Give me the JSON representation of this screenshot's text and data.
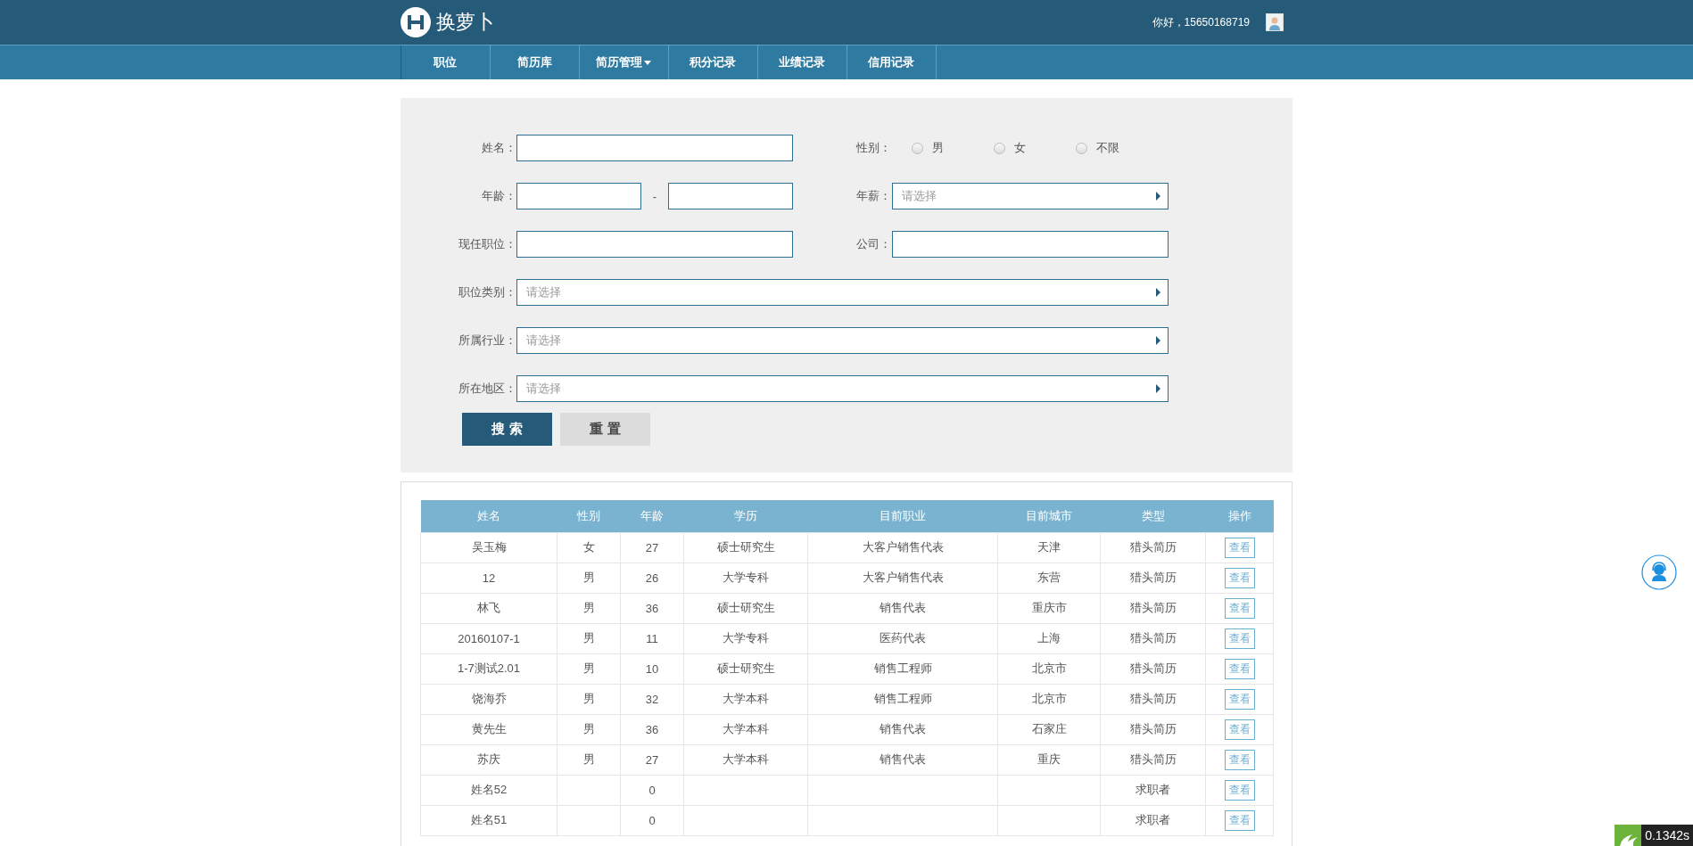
{
  "header": {
    "logo_text": "换萝卜",
    "greeting": "你好，15650168719"
  },
  "nav": [
    {
      "label": "职位",
      "dropdown": false
    },
    {
      "label": "简历库",
      "dropdown": false
    },
    {
      "label": "简历管理",
      "dropdown": true
    },
    {
      "label": "积分记录",
      "dropdown": false
    },
    {
      "label": "业绩记录",
      "dropdown": false
    },
    {
      "label": "信用记录",
      "dropdown": false
    }
  ],
  "form": {
    "name": {
      "label": "姓名："
    },
    "gender": {
      "label": "性别：",
      "options": [
        {
          "label": "男",
          "selected": false
        },
        {
          "label": "女",
          "selected": false
        },
        {
          "label": "不限",
          "selected": false
        }
      ]
    },
    "age": {
      "label": "年龄：",
      "separator": "-"
    },
    "salary": {
      "label": "年薪：",
      "placeholder": "请选择"
    },
    "position": {
      "label": "现任职位："
    },
    "company": {
      "label": "公司："
    },
    "selects": [
      {
        "label": "职位类别：",
        "placeholder": "请选择"
      },
      {
        "label": "所属行业：",
        "placeholder": "请选择"
      },
      {
        "label": "所在地区：",
        "placeholder": "请选择"
      }
    ],
    "buttons": [
      {
        "label": "搜 索",
        "kind": "primary"
      },
      {
        "label": "重 置",
        "kind": "secondary"
      }
    ]
  },
  "table": {
    "columns": [
      "姓名",
      "性别",
      "年龄",
      "学历",
      "目前职业",
      "目前城市",
      "类型",
      "操作"
    ],
    "rows": [
      {
        "cells": [
          "吴玉梅",
          "女",
          "27",
          "硕士研究生",
          "大客户销售代表",
          "天津",
          "猎头简历"
        ],
        "action": "查看"
      },
      {
        "cells": [
          "12",
          "男",
          "26",
          "大学专科",
          "大客户销售代表",
          "东营",
          "猎头简历"
        ],
        "action": "查看"
      },
      {
        "cells": [
          "林飞",
          "男",
          "36",
          "硕士研究生",
          "销售代表",
          "重庆市",
          "猎头简历"
        ],
        "action": "查看"
      },
      {
        "cells": [
          "20160107-1",
          "男",
          "11",
          "大学专科",
          "医药代表",
          "上海",
          "猎头简历"
        ],
        "action": "查看"
      },
      {
        "cells": [
          "1-7测试2.01",
          "男",
          "10",
          "硕士研究生",
          "销售工程师",
          "北京市",
          "猎头简历"
        ],
        "action": "查看"
      },
      {
        "cells": [
          "饶海乔",
          "男",
          "32",
          "大学本科",
          "销售工程师",
          "北京市",
          "猎头简历"
        ],
        "action": "查看"
      },
      {
        "cells": [
          "黄先生",
          "男",
          "36",
          "大学本科",
          "销售代表",
          "石家庄",
          "猎头简历"
        ],
        "action": "查看"
      },
      {
        "cells": [
          "苏庆",
          "男",
          "27",
          "大学本科",
          "销售代表",
          "重庆",
          "猎头简历"
        ],
        "action": "查看"
      },
      {
        "cells": [
          "姓名52",
          "",
          "0",
          "",
          "",
          "",
          "求职者"
        ],
        "action": "查看"
      },
      {
        "cells": [
          "姓名51",
          "",
          "0",
          "",
          "",
          "",
          "求职者"
        ],
        "action": "查看"
      }
    ]
  },
  "timer_badge": "0.1342s"
}
